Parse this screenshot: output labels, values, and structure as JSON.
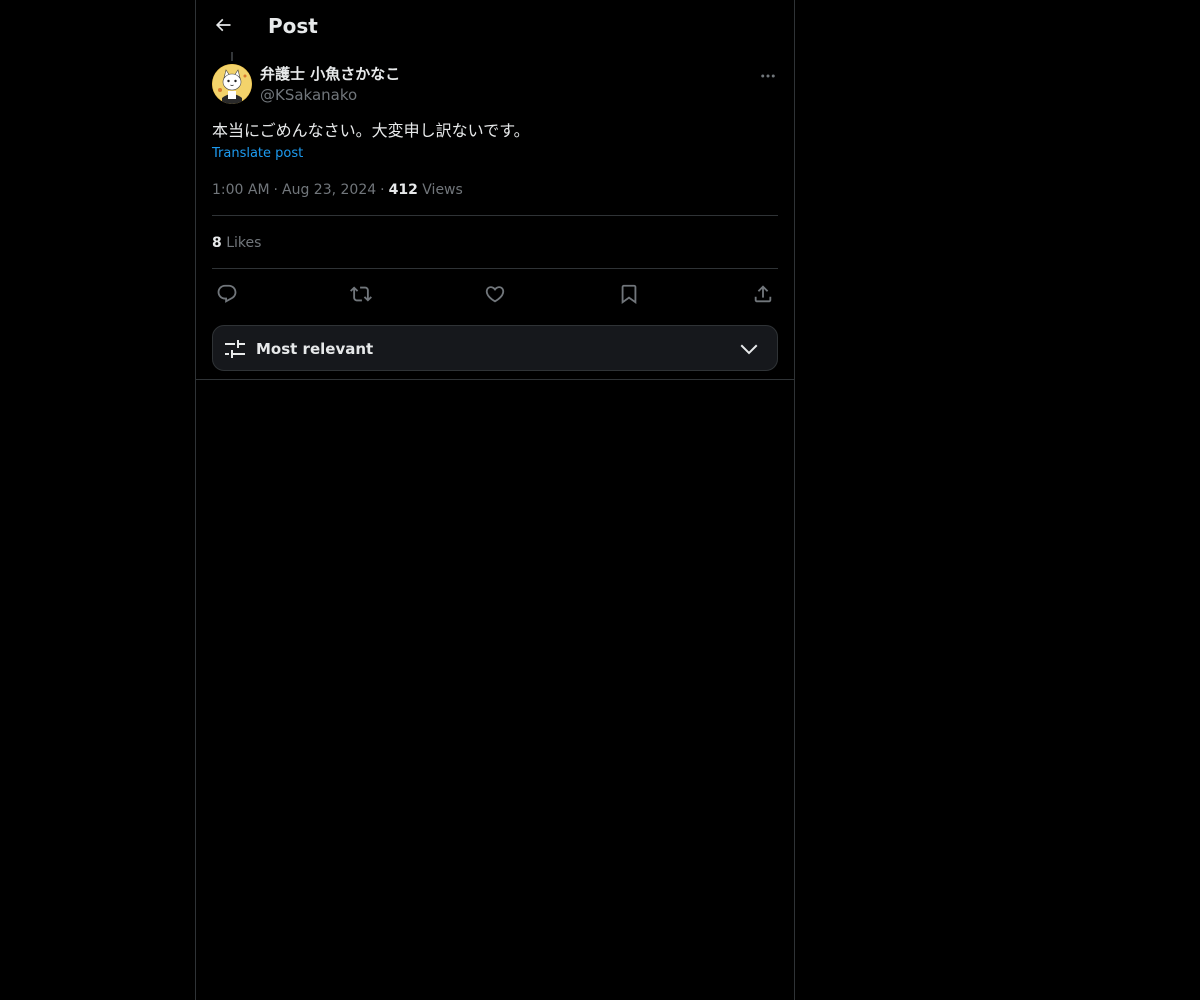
{
  "header": {
    "title": "Post",
    "back_icon": "arrow-left-icon"
  },
  "post": {
    "author_name": "弁護士 小魚さかなこ",
    "author_handle": "@KSakanako",
    "avatar_icon": "cat-avatar",
    "text": "本当にごめんなさい。大変申し訳ないです。",
    "translate_label": "Translate post",
    "time": "1:00 AM",
    "separator": "·",
    "date": "Aug 23, 2024",
    "views_count": "412",
    "views_label": "Views",
    "likes_count": "8",
    "likes_label": "Likes"
  },
  "actions": [
    "reply-icon",
    "repost-icon",
    "like-icon",
    "bookmark-icon",
    "share-icon"
  ],
  "sort": {
    "label": "Most relevant",
    "icon": "sliders-icon",
    "chevron": "chevron-down-icon"
  },
  "colors": {
    "background": "#000000",
    "text": "#e7e9ea",
    "secondary": "#71767b",
    "accent": "#1d9bf0",
    "border": "#2f3336"
  }
}
